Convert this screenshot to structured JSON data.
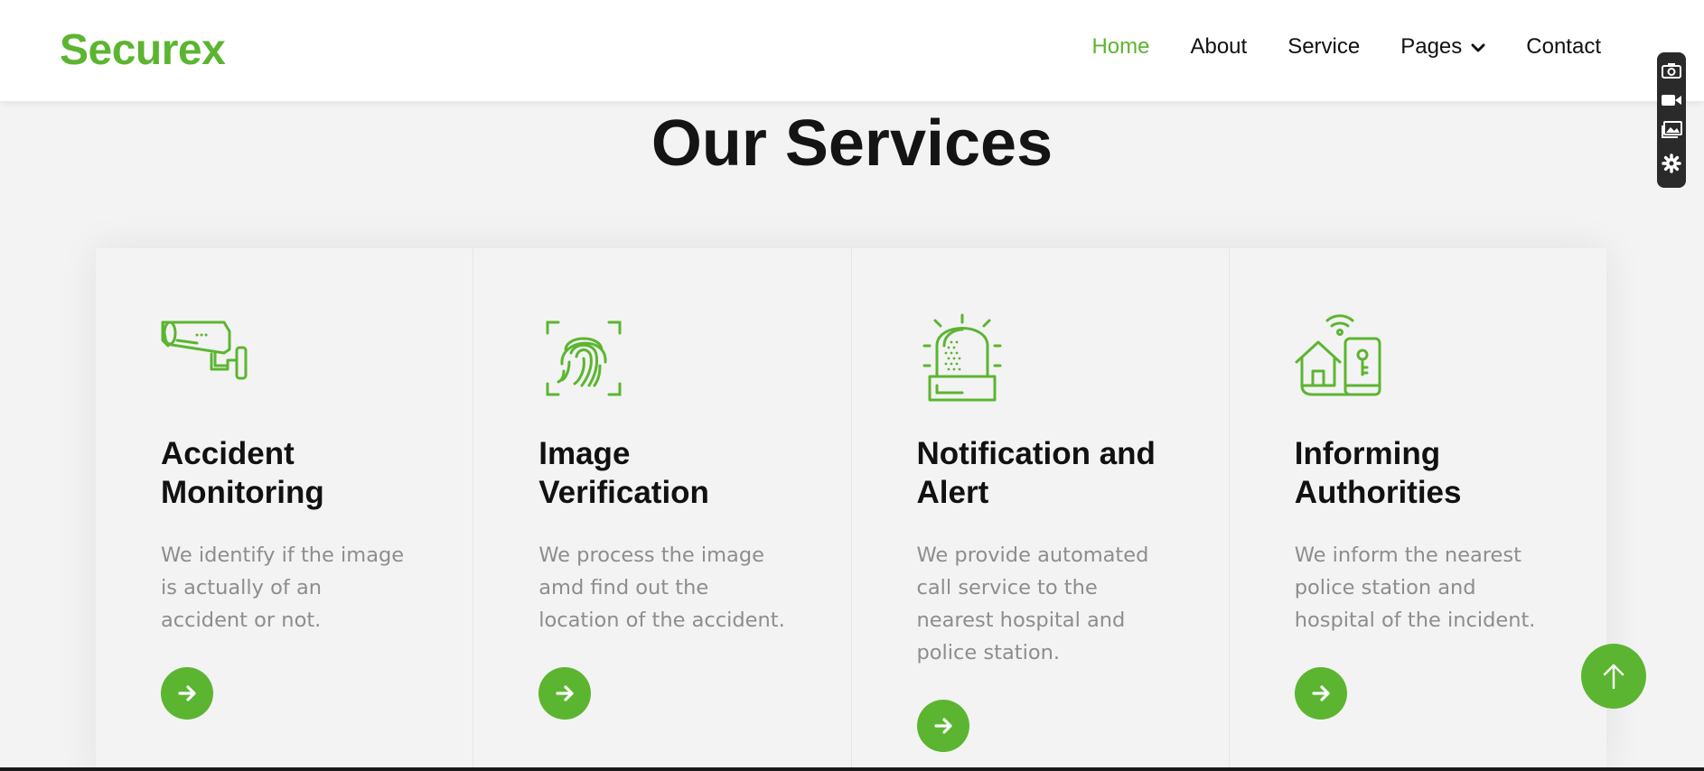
{
  "colors": {
    "accent": "#5cb531",
    "text_dark": "#111111",
    "text_muted": "#8d8d8d",
    "background": "#f3f3f3"
  },
  "header": {
    "brand": "Securex",
    "nav": [
      {
        "label": "Home",
        "active": true
      },
      {
        "label": "About",
        "active": false
      },
      {
        "label": "Service",
        "active": false
      },
      {
        "label": "Pages",
        "active": false,
        "has_dropdown": true
      },
      {
        "label": "Contact",
        "active": false
      }
    ]
  },
  "section": {
    "title": "Our Services"
  },
  "services": [
    {
      "icon": "cctv-camera-icon",
      "title": "Accident Monitoring",
      "description": "We identify if the image is actually of an accident or not."
    },
    {
      "icon": "fingerprint-icon",
      "title": "Image Verification",
      "description": "We process the image amd find out the location of the accident."
    },
    {
      "icon": "alarm-siren-icon",
      "title": "Notification and Alert",
      "description": "We provide automated call service to the nearest hospital and police station."
    },
    {
      "icon": "smart-home-icon",
      "title": "Informing Authorities",
      "description": "We inform the nearest police station and hospital of the incident."
    }
  ],
  "side_tools": [
    "camera-icon",
    "video-icon",
    "gallery-icon",
    "settings-icon"
  ]
}
